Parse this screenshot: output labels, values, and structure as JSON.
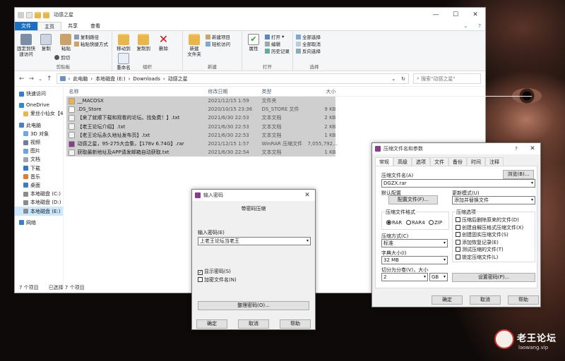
{
  "explorer": {
    "title": "动感之星",
    "tabs": [
      "文件",
      "主页",
      "共享",
      "查看"
    ],
    "ribbon": {
      "clipboard": {
        "pin": "固定到快\n速访问",
        "copy": "复制",
        "paste": "粘贴",
        "copy_path": "复制路径",
        "paste_shortcut": "粘贴快捷方式",
        "cut": "剪切",
        "label": "剪贴板"
      },
      "organize": {
        "move_to": "移动到",
        "copy_to": "复制到",
        "delete": "删除",
        "rename": "重命名",
        "label": "组织"
      },
      "new": {
        "new_folder": "新建\n文件夹",
        "new_item": "新建项目",
        "easy_access": "轻松访问",
        "label": "新建"
      },
      "open": {
        "properties": "属性",
        "open": "打开",
        "edit": "编辑",
        "history": "历史记录",
        "label": "打开"
      },
      "select": {
        "select_all": "全部选择",
        "select_none": "全部取消",
        "invert": "反向选择",
        "label": "选择"
      }
    },
    "breadcrumb": [
      "此电脑",
      "本地磁盘 (E:)",
      "Downloads",
      "动感之星"
    ],
    "search_placeholder": "搜索\"动感之星\"",
    "sidebar": [
      {
        "icon": "star-icon",
        "label": "快速访问"
      },
      {
        "icon": "cloud-icon",
        "label": "OneDrive"
      },
      {
        "icon": "folder-icon",
        "label": "爱丝小仙女【4"
      },
      {
        "icon": "pc-icon",
        "label": "此电脑"
      },
      {
        "icon": "cube-icon",
        "label": "3D 对象"
      },
      {
        "icon": "video-icon",
        "label": "视频"
      },
      {
        "icon": "picture-icon",
        "label": "图片"
      },
      {
        "icon": "document-icon",
        "label": "文档"
      },
      {
        "icon": "download-icon",
        "label": "下载"
      },
      {
        "icon": "music-icon",
        "label": "音乐"
      },
      {
        "icon": "desktop-icon",
        "label": "桌面"
      },
      {
        "icon": "drive-icon",
        "label": "本地磁盘 (C:)"
      },
      {
        "icon": "drive-icon",
        "label": "本地磁盘 (D:)"
      },
      {
        "icon": "drive-icon",
        "label": "本地磁盘 (E:)"
      },
      {
        "icon": "network-icon",
        "label": "网络"
      }
    ],
    "columns": [
      "名称",
      "修改日期",
      "类型",
      "大小"
    ],
    "files": [
      {
        "name": "__MACOSX",
        "date": "2021/12/15 1:59",
        "type": "文件夹",
        "size": "",
        "icon": "folder"
      },
      {
        "name": ".DS_Store",
        "date": "2020/10/15 23:36",
        "type": "DS_STORE 文件",
        "size": "9 KB",
        "icon": "file"
      },
      {
        "name": "【来了就顺下载和观看的论坛。找免费！】.txt",
        "date": "2021/6/30 22:53",
        "type": "文本文档",
        "size": "2 KB",
        "icon": "txt"
      },
      {
        "name": "【老王论坛介绍】.txt",
        "date": "2021/6/30 22:53",
        "type": "文本文档",
        "size": "2 KB",
        "icon": "txt"
      },
      {
        "name": "【老王论坛永久地址发布页】.txt",
        "date": "2021/6/30 22:53",
        "type": "文本文档",
        "size": "1 KB",
        "icon": "txt"
      },
      {
        "name": "动感之星，95-275大合集，【178v 6.74G】.rar",
        "date": "2021/12/15 1:57",
        "type": "WinRAR 压缩文件",
        "size": "7,055,792...",
        "icon": "rar"
      },
      {
        "name": "获取最新地址及APP请发邮箱自动获取.txt",
        "date": "2021/6/30 22:54",
        "type": "文本文档",
        "size": "1 KB",
        "icon": "txt"
      }
    ],
    "status": {
      "count": "7 个项目",
      "selected": "已选择 7 个项目"
    }
  },
  "password_dialog": {
    "title": "输入密码",
    "heading": "带密码压缩",
    "prompt_label": "输入密码(E)",
    "password_value": "上老王论坛当老王",
    "show_password": "显示密码(S)",
    "encrypt_names": "加密文件名(N)",
    "organize_btn": "整理密码(O)...",
    "ok": "确定",
    "cancel": "取消",
    "help": "帮助"
  },
  "archive_dialog": {
    "title": "压缩文件名和参数",
    "tabs": [
      "常规",
      "高级",
      "选项",
      "文件",
      "备份",
      "时间",
      "注释"
    ],
    "archive_name_label": "压缩文件名(A)",
    "browse": "浏览(B)...",
    "archive_name": "DGZX.rar",
    "default_profile_label": "默认配置",
    "profile_btn": "配置文件(F)...",
    "update_mode_label": "更新模式(U)",
    "update_mode": "添加并替换文件",
    "format_label": "压缩文件格式",
    "formats": [
      "RAR",
      "RAR4",
      "ZIP"
    ],
    "method_label": "压缩方式(C)",
    "method": "标准",
    "dict_label": "字典大小(I)",
    "dict": "32 MB",
    "split_label": "切分为分卷(V)，大小",
    "split_value": "2",
    "split_unit": "GB",
    "options_label": "压缩选项",
    "options": [
      "压缩后删除原来的文件(D)",
      "创建自解压格式压缩文件(X)",
      "创建固实压缩文件(S)",
      "添加恢复记录(E)",
      "测试压缩的文件(T)",
      "锁定压缩文件(L)"
    ],
    "set_password": "设置密码(P)...",
    "ok": "确定",
    "cancel": "取消",
    "help": "帮助"
  },
  "watermark": {
    "name": "老王论坛",
    "url": "laowang.vip"
  }
}
